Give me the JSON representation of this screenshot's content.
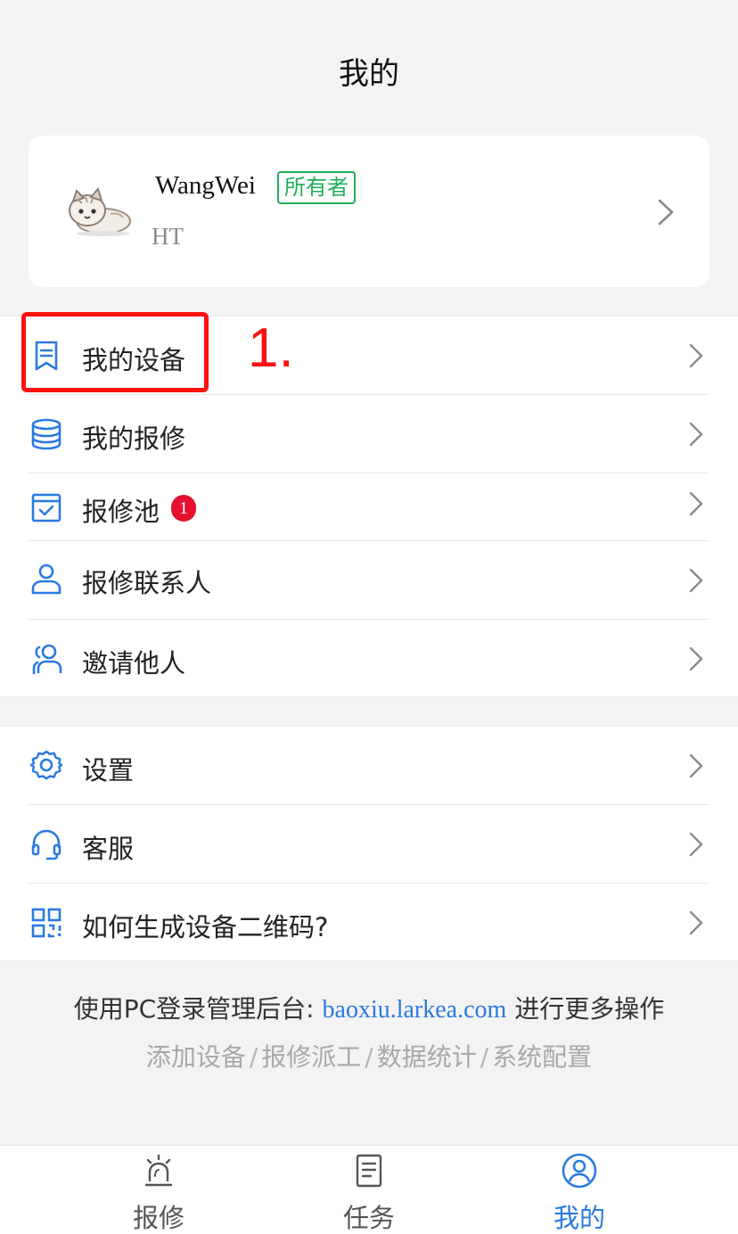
{
  "header": {
    "title": "我的"
  },
  "profile": {
    "name": "WangWei",
    "role_badge": "所有者",
    "organization": "HT"
  },
  "menu_group_1": [
    {
      "label": "我的设备",
      "icon": "bookmark-list-icon"
    },
    {
      "label": "我的报修",
      "icon": "database-stack-icon"
    },
    {
      "label": "报修池",
      "icon": "calendar-check-icon",
      "badge": "1"
    },
    {
      "label": "报修联系人",
      "icon": "user-icon"
    },
    {
      "label": "邀请他人",
      "icon": "users-icon"
    }
  ],
  "menu_group_2": [
    {
      "label": "设置",
      "icon": "gear-icon"
    },
    {
      "label": "客服",
      "icon": "headset-icon"
    },
    {
      "label": "如何生成设备二维码?",
      "icon": "qr-code-icon"
    }
  ],
  "annotation": {
    "text": "1."
  },
  "footer": {
    "prefix": "使用PC登录管理后台:",
    "link": "baoxiu.larkea.com",
    "suffix": "进行更多操作",
    "features": [
      "添加设备",
      "报修派工",
      "数据统计",
      "系统配置"
    ],
    "separator": "/"
  },
  "tab_bar": [
    {
      "label": "报修",
      "icon": "alarm-light-icon"
    },
    {
      "label": "任务",
      "icon": "document-icon"
    },
    {
      "label": "我的",
      "icon": "user-circle-icon",
      "active": true
    }
  ],
  "colors": {
    "accent": "#2a7ae2",
    "badge_green": "#1fae5b",
    "badge_red": "#e5102f",
    "annotation_red": "#ff1010"
  }
}
